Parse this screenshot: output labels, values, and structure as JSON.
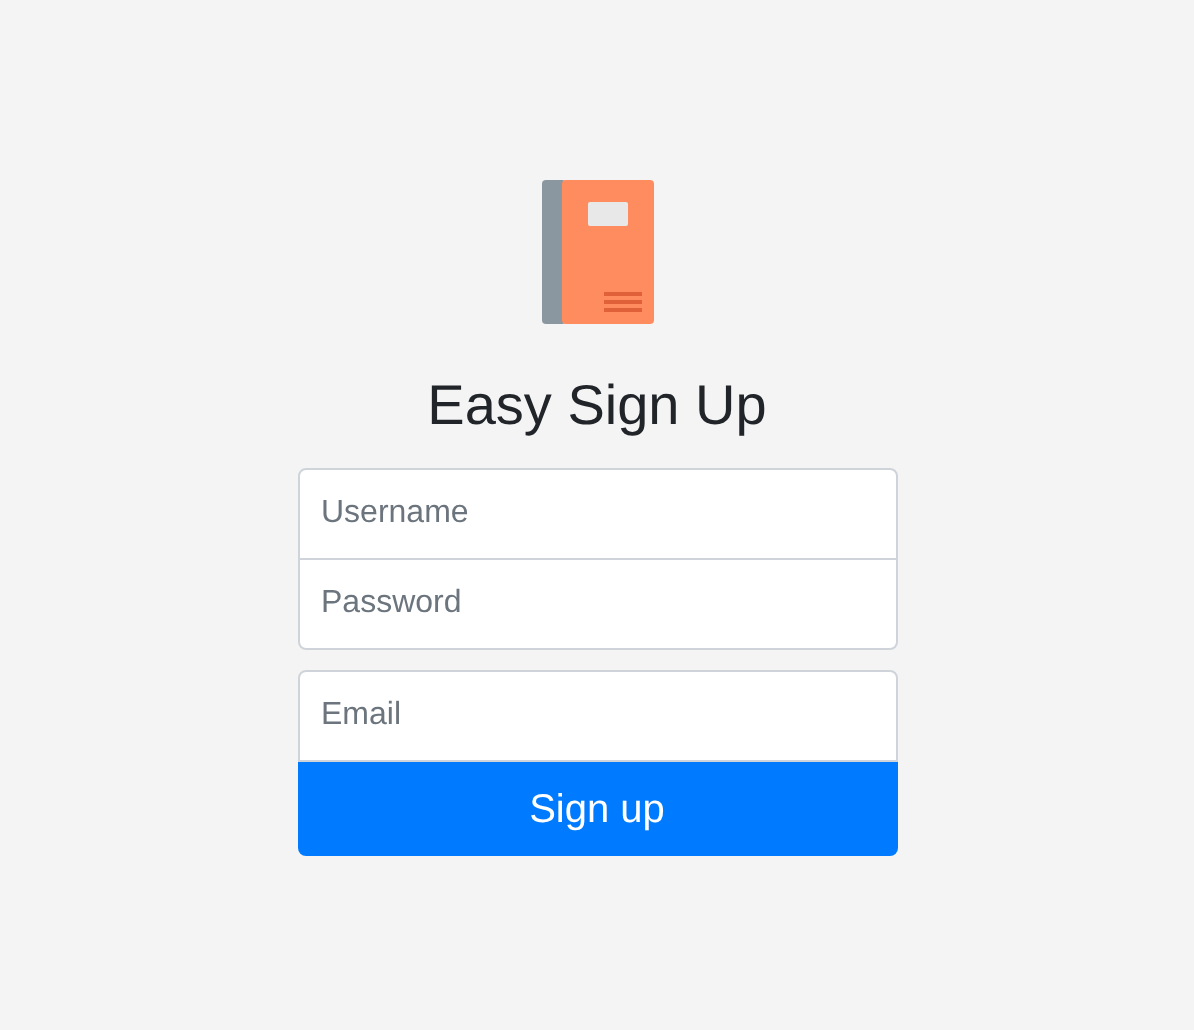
{
  "title": "Easy Sign Up",
  "fields": [
    {
      "placeholder": "Username"
    },
    {
      "placeholder": "Password"
    },
    {
      "placeholder": "Email"
    }
  ],
  "button": "Sign up"
}
